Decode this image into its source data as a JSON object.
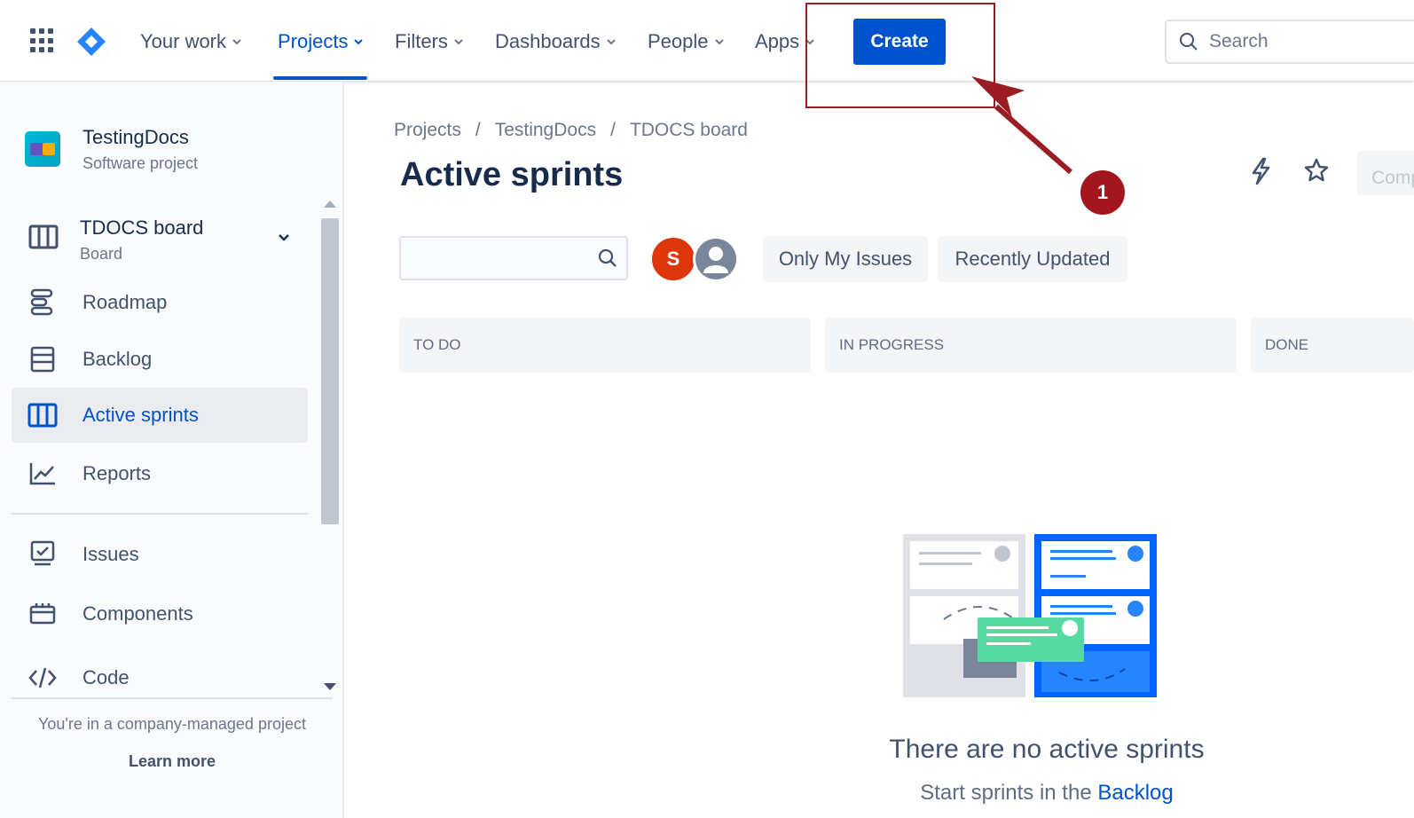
{
  "topnav": {
    "items": [
      {
        "label": "Your work",
        "active": false
      },
      {
        "label": "Projects",
        "active": true
      },
      {
        "label": "Filters",
        "active": false
      },
      {
        "label": "Dashboards",
        "active": false
      },
      {
        "label": "People",
        "active": false
      },
      {
        "label": "Apps",
        "active": false
      }
    ],
    "create_label": "Create",
    "search_placeholder": "Search"
  },
  "annotation": {
    "badge": "1",
    "color": "#9b1c22"
  },
  "sidebar": {
    "project_name": "TestingDocs",
    "project_type": "Software project",
    "board_name": "TDOCS board",
    "board_sub": "Board",
    "items": [
      {
        "label": "Roadmap",
        "icon": "roadmap-icon"
      },
      {
        "label": "Backlog",
        "icon": "backlog-icon"
      },
      {
        "label": "Active sprints",
        "icon": "board-columns-icon",
        "selected": true
      },
      {
        "label": "Reports",
        "icon": "chart-line-icon"
      },
      {
        "label": "Issues",
        "icon": "issues-icon"
      },
      {
        "label": "Components",
        "icon": "components-icon"
      },
      {
        "label": "Code",
        "icon": "code-icon"
      }
    ],
    "footer_msg": "You're in a company-managed project",
    "footer_link": "Learn more"
  },
  "main": {
    "breadcrumb": [
      "Projects",
      "TestingDocs",
      "TDOCS board"
    ],
    "breadcrumb_sep": "/",
    "title": "Active sprints",
    "complete_label": "Comp",
    "avatar_initial": "S",
    "filters": [
      "Only My Issues",
      "Recently Updated"
    ],
    "columns": [
      "TO DO",
      "IN PROGRESS",
      "DONE"
    ],
    "empty_title": "There are no active sprints",
    "empty_sub_prefix": "Start sprints in the",
    "empty_sub_link": "Backlog"
  },
  "colors": {
    "brand": "#0052cc",
    "text": "#172b4d",
    "muted": "#6b778c"
  }
}
